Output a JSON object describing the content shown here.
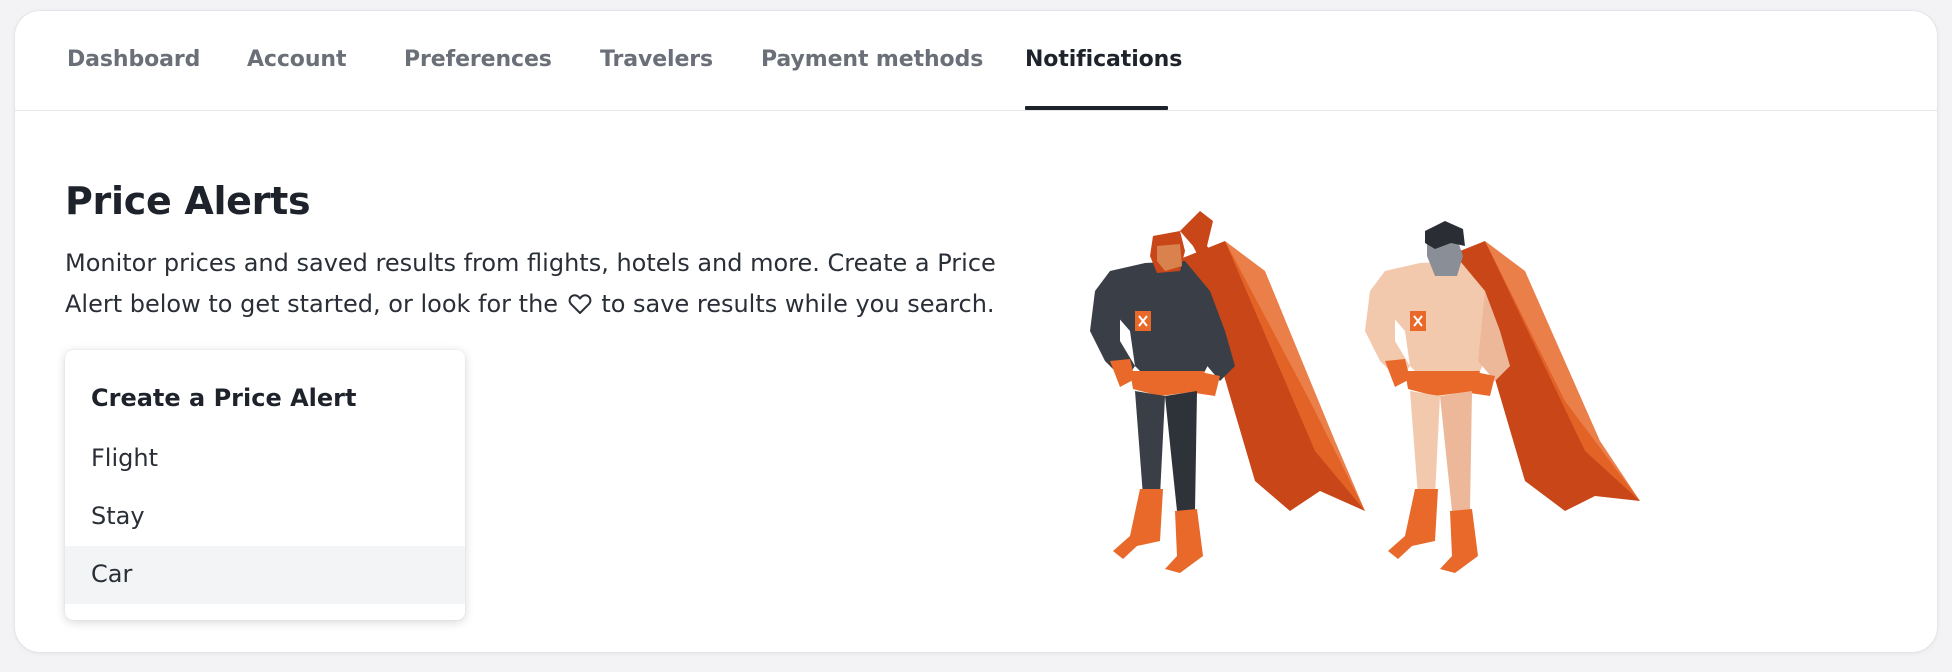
{
  "tabs": [
    {
      "label": "Dashboard"
    },
    {
      "label": "Account"
    },
    {
      "label": "Preferences"
    },
    {
      "label": "Travelers"
    },
    {
      "label": "Payment methods"
    },
    {
      "label": "Notifications",
      "active": true
    }
  ],
  "page": {
    "title": "Price Alerts",
    "description_part1": "Monitor prices and saved results from flights, hotels and more. Create a Price Alert below to get started, or look for the",
    "heart_icon": "heart-outline-icon",
    "description_part2": "to save results while you search."
  },
  "dropdown": {
    "title": "Create a Price Alert",
    "items": [
      {
        "label": "Flight"
      },
      {
        "label": "Stay"
      },
      {
        "label": "Car",
        "hovered": true
      }
    ]
  },
  "illustration": {
    "name": "superheroes-illustration",
    "colors": {
      "orange": "#e8692a",
      "cape": "#c94618",
      "dark_suit": "#3a3f47",
      "light_suit": "#f3c9ad"
    }
  }
}
